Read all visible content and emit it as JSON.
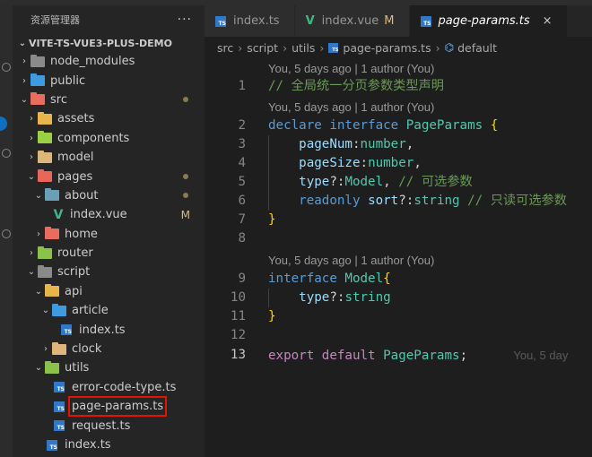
{
  "sidebar": {
    "title": "资源管理器",
    "more": "···",
    "project": "VITE-TS-VUE3-PLUS-DEMO",
    "items": [
      {
        "label": "node_modules",
        "depth": 1,
        "kind": "folder",
        "color": "#8a8a8a",
        "chev": "›",
        "mark": ""
      },
      {
        "label": "public",
        "depth": 1,
        "kind": "folder",
        "color": "#3f9be0",
        "chev": "›",
        "mark": ""
      },
      {
        "label": "src",
        "depth": 1,
        "kind": "folder",
        "color": "#e86d5e",
        "chev": "⌄",
        "mark": "dot"
      },
      {
        "label": "assets",
        "depth": 2,
        "kind": "folder",
        "color": "#e8b54a",
        "chev": "›",
        "mark": ""
      },
      {
        "label": "components",
        "depth": 2,
        "kind": "folder",
        "color": "#9ad144",
        "chev": "›",
        "mark": ""
      },
      {
        "label": "model",
        "depth": 2,
        "kind": "folder",
        "color": "#dcb67a",
        "chev": "›",
        "mark": ""
      },
      {
        "label": "pages",
        "depth": 2,
        "kind": "folder",
        "color": "#e9675a",
        "chev": "⌄",
        "mark": "dot"
      },
      {
        "label": "about",
        "depth": 3,
        "kind": "folder",
        "color": "#6a9fb5",
        "chev": "⌄",
        "mark": "dot"
      },
      {
        "label": "index.vue",
        "depth": 4,
        "kind": "vue",
        "color": "#41b883",
        "chev": "",
        "mark": "M"
      },
      {
        "label": "home",
        "depth": 3,
        "kind": "folder",
        "color": "#e86d5e",
        "chev": "›",
        "mark": ""
      },
      {
        "label": "router",
        "depth": 2,
        "kind": "folder",
        "color": "#8bc34a",
        "chev": "›",
        "mark": ""
      },
      {
        "label": "script",
        "depth": 2,
        "kind": "folder",
        "color": "#8a8a8a",
        "chev": "⌄",
        "mark": ""
      },
      {
        "label": "api",
        "depth": 3,
        "kind": "folder",
        "color": "#e8b54a",
        "chev": "⌄",
        "mark": ""
      },
      {
        "label": "article",
        "depth": 4,
        "kind": "folder",
        "color": "#3f9be0",
        "chev": "⌄",
        "mark": ""
      },
      {
        "label": "index.ts",
        "depth": 5,
        "kind": "ts",
        "color": "#3178c6",
        "chev": "",
        "mark": ""
      },
      {
        "label": "clock",
        "depth": 4,
        "kind": "folder",
        "color": "#dcb67a",
        "chev": "›",
        "mark": ""
      },
      {
        "label": "utils",
        "depth": 3,
        "kind": "folder",
        "color": "#8bc34a",
        "chev": "⌄",
        "mark": ""
      },
      {
        "label": "error-code-type.ts",
        "depth": 4,
        "kind": "ts",
        "color": "#3178c6",
        "chev": "",
        "mark": ""
      },
      {
        "label": "page-params.ts",
        "depth": 4,
        "kind": "ts",
        "color": "#3178c6",
        "chev": "",
        "mark": "",
        "highlight": true
      },
      {
        "label": "request.ts",
        "depth": 4,
        "kind": "ts",
        "color": "#3178c6",
        "chev": "",
        "mark": ""
      },
      {
        "label": "index.ts",
        "depth": 3,
        "kind": "ts",
        "color": "#3178c6",
        "chev": "",
        "mark": ""
      }
    ]
  },
  "tabs": [
    {
      "label": "index.ts",
      "icon": "ts",
      "modified": "",
      "active": false
    },
    {
      "label": "index.vue",
      "icon": "vue",
      "modified": "M",
      "active": false
    },
    {
      "label": "page-params.ts",
      "icon": "ts",
      "modified": "",
      "active": true,
      "close": "×"
    }
  ],
  "breadcrumb": {
    "parts": [
      "src",
      "script",
      "utils"
    ],
    "file": "page-params.ts",
    "symbol": "default",
    "symbol_icon": "⌬"
  },
  "editor": {
    "lens_text": "You, 5 days ago | 1 author (You)",
    "inline_blame": "You, 5 day"
  },
  "colors": {
    "keyword": "#569cd6",
    "type": "#4ec9b0",
    "property": "#9cdcfe",
    "comment": "#6a9955",
    "highlight_box": "#e51400"
  }
}
